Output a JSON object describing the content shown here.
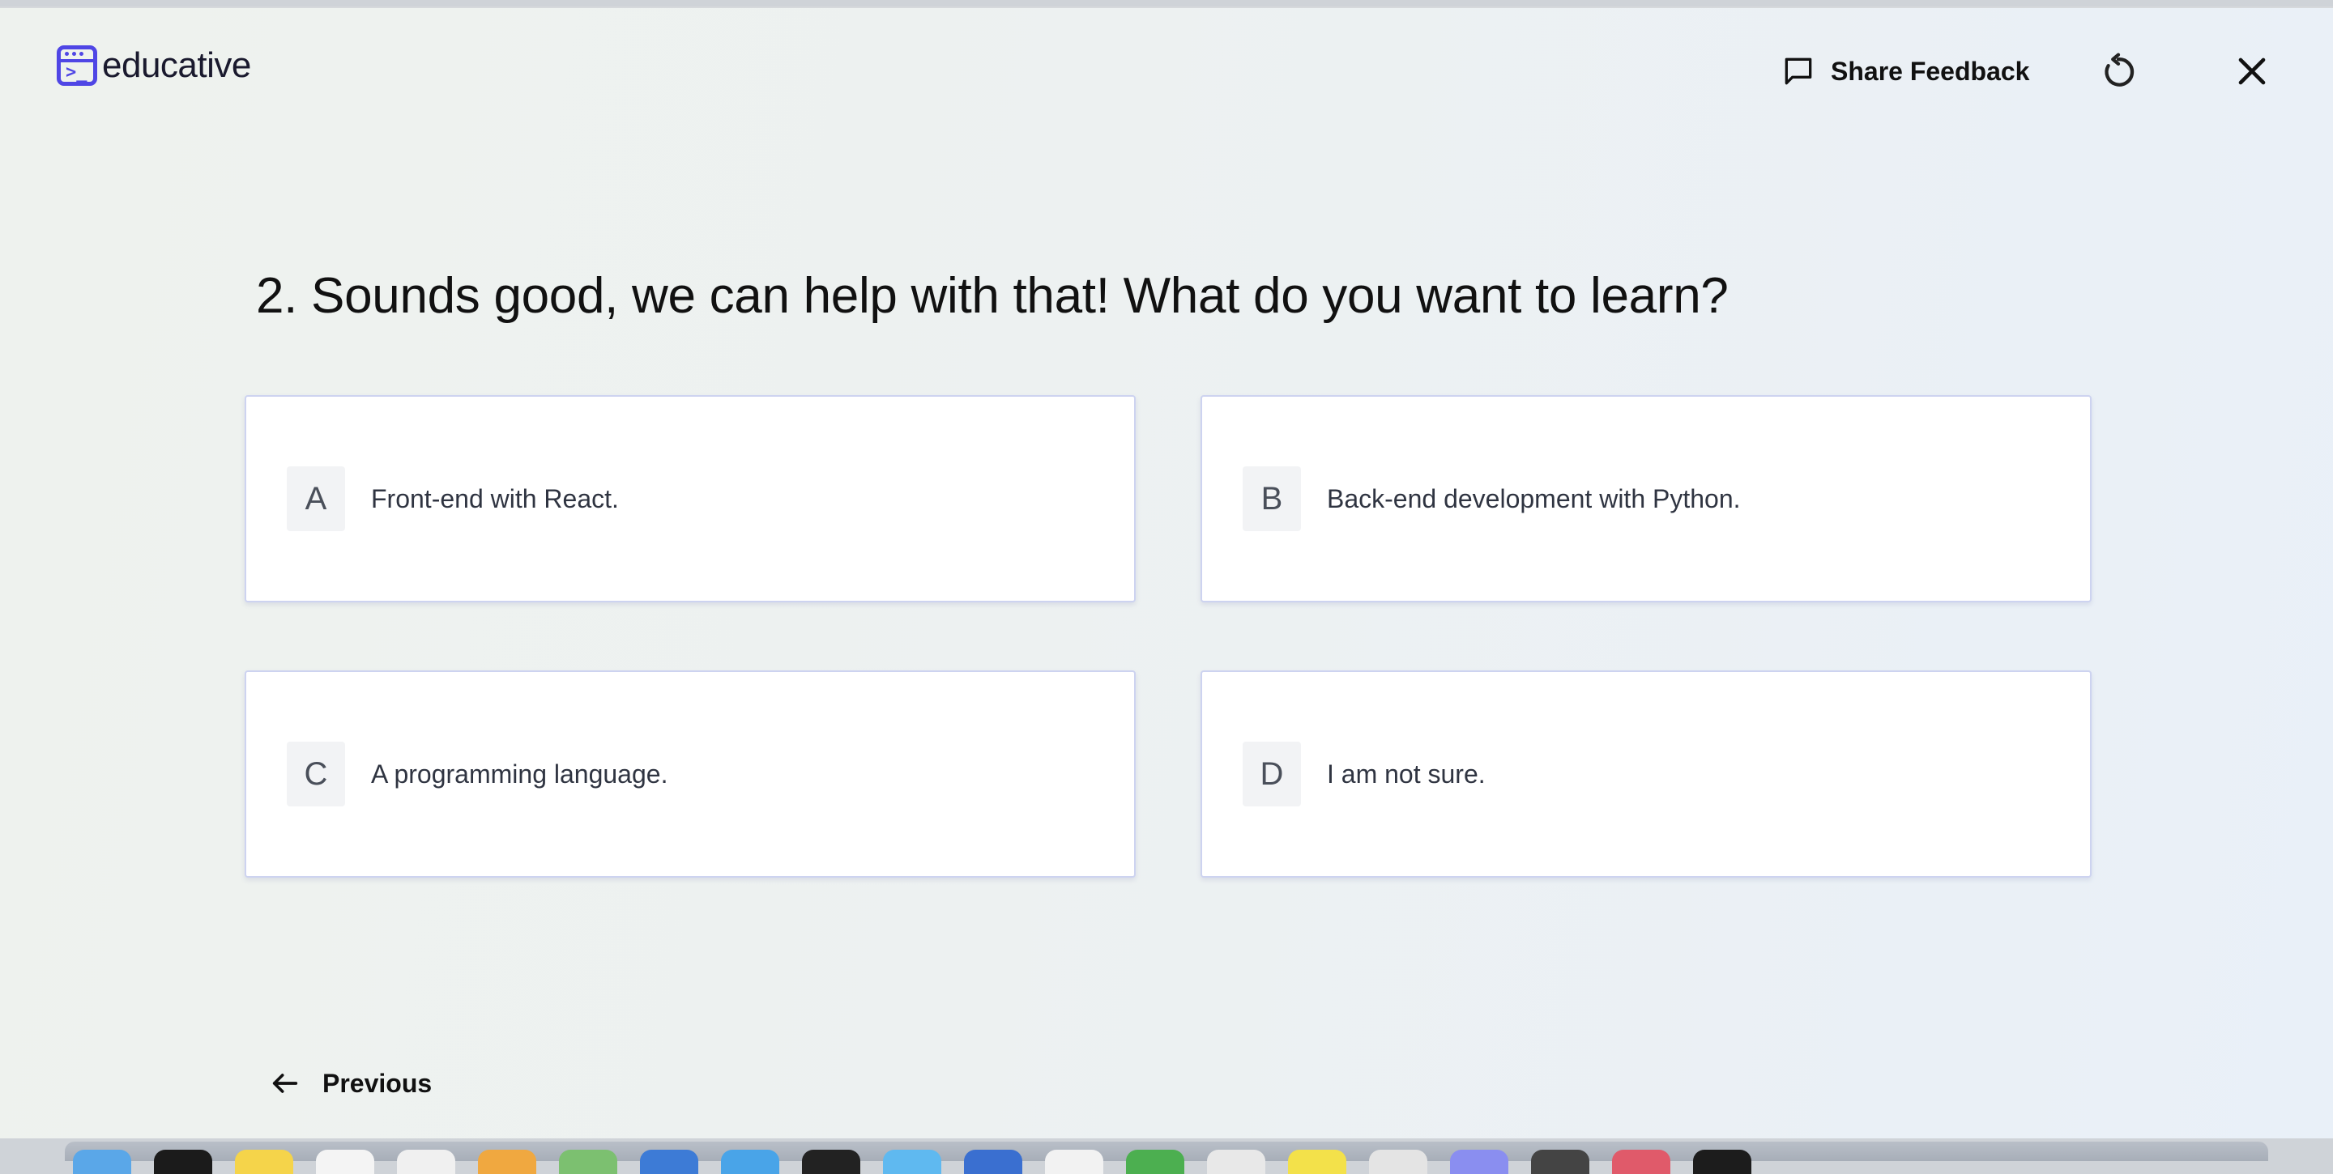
{
  "app": {
    "logo_text": "educative"
  },
  "header": {
    "feedback_label": "Share Feedback",
    "icons": {
      "feedback": "chat-bubble-icon",
      "restart": "restart-icon",
      "close": "close-icon"
    }
  },
  "quiz": {
    "question": "2. Sounds good, we can help with that! What do you want to learn?",
    "options": [
      {
        "letter": "A",
        "text": "Front-end with React."
      },
      {
        "letter": "B",
        "text": "Back-end development with Python."
      },
      {
        "letter": "C",
        "text": "A programming language."
      },
      {
        "letter": "D",
        "text": "I am not sure."
      }
    ]
  },
  "footer": {
    "previous_label": "Previous"
  },
  "colors": {
    "brand": "#4f46e5",
    "card_border": "#cdd3f0",
    "letter_bg": "#f2f3f5"
  }
}
